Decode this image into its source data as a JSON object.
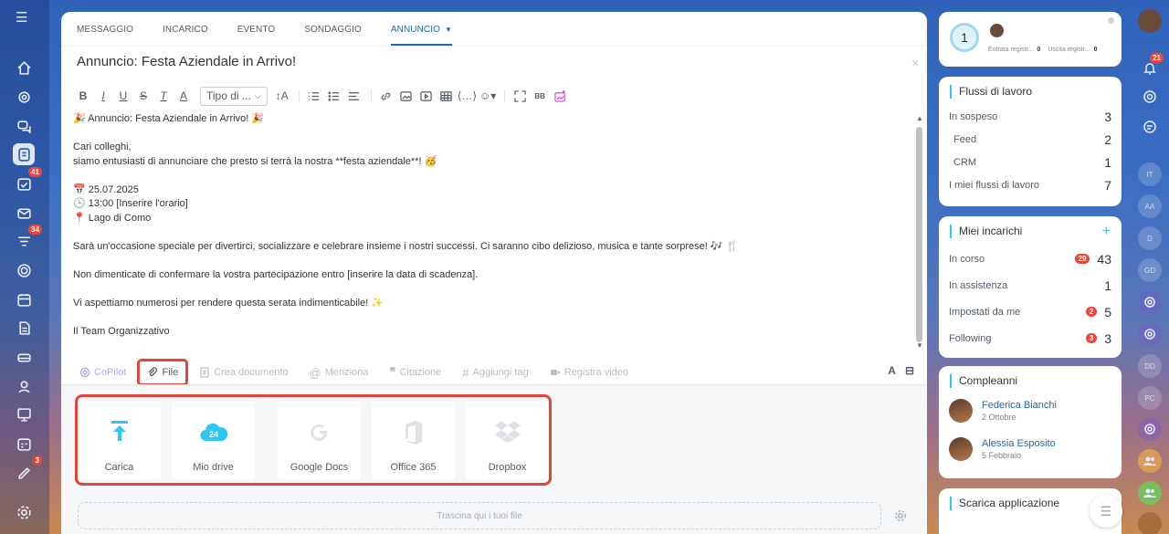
{
  "composer": {
    "tabs": [
      "MESSAGGIO",
      "INCARICO",
      "EVENTO",
      "SONDAGGIO",
      "ANNUNCIO"
    ],
    "active_tab": "ANNUNCIO",
    "title": "Annuncio: Festa Aziendale in Arrivo!",
    "toolbar": {
      "font_select": "Tipo di ...",
      "bbcode_label": "BB"
    },
    "editor_lines": [
      "🎉 Annuncio: Festa Aziendale in Arrivo! 🎉",
      "",
      "Cari colleghi,",
      "siamo entusiasti di annunciare che presto si terrà la nostra **festa aziendale**! 🥳",
      "",
      "📅 25.07.2025",
      "🕒 13:00 [Inserire l'orario]",
      "📍 Lago di Como",
      "",
      "Sarà un'occasione speciale per divertirci, socializzare e celebrare insieme i nostri successi. Ci saranno cibo delizioso, musica e tante sorprese! 🎶 🍴",
      "",
      "Non dimenticate di confermare la vostra partecipazione entro [inserire la data di scadenza].",
      "",
      "Vi aspettiamo numerosi per rendere questa serata indimenticabile! ✨",
      "",
      "Il Team Organizzativo"
    ],
    "bottom_actions": {
      "copilot": "CoPilot",
      "file": "File",
      "create_doc": "Crea documento",
      "mention": "Menziona",
      "quote": "Citazione",
      "tag": "Aggiungi tag",
      "video": "Registra video"
    },
    "upload_providers": [
      {
        "label": "Carica",
        "icon": "upload-icon"
      },
      {
        "label": "Mio drive",
        "icon": "cloud-drive-icon",
        "badge": "24"
      },
      {
        "label": "Google Docs",
        "icon": "google-icon"
      },
      {
        "label": "Office 365",
        "icon": "office-icon"
      },
      {
        "label": "Dropbox",
        "icon": "dropbox-icon"
      }
    ],
    "dropzone": "Trascina qui i tuoi file"
  },
  "right_panel": {
    "attendance": {
      "count": "1",
      "entry_label": "Entrata registr...",
      "entry_value": "0",
      "exit_label": "Uscita registr...",
      "exit_value": "0"
    },
    "workflows": {
      "title": "Flussi di lavoro",
      "rows": [
        {
          "label": "In sospeso",
          "value": "3"
        },
        {
          "label": "Feed",
          "value": "2"
        },
        {
          "label": "CRM",
          "value": "1"
        },
        {
          "label": "I miei flussi di lavoro",
          "value": "7"
        }
      ]
    },
    "tasks": {
      "title": "Miei incarichi",
      "plus": "+",
      "rows": [
        {
          "label": "In corso",
          "badge": "29",
          "value": "43"
        },
        {
          "label": "In assistenza",
          "badge": "",
          "value": "1"
        },
        {
          "label": "Impostati da me",
          "badge": "2",
          "value": "5"
        },
        {
          "label": "Following",
          "badge": "3",
          "value": "3"
        }
      ]
    },
    "birthdays": {
      "title": "Compleanni",
      "people": [
        {
          "name": "Federica Bianchi",
          "date": "2 Ottobre"
        },
        {
          "name": "Alessia Esposito",
          "date": "5 Febbraio"
        }
      ]
    },
    "apps": {
      "title": "Scarica applicazione"
    }
  },
  "left_sidebar": {
    "badges": {
      "tasks": "41",
      "feed": "34",
      "extra": "3"
    }
  },
  "right_sidebar": {
    "notifications": "21",
    "avatars": [
      "IT",
      "AA",
      "D",
      "GD",
      "DD",
      "PC"
    ]
  },
  "colors": {
    "accent": "#2066b0",
    "badge_red": "#f0453b",
    "highlight_box": "#e0463c",
    "card_line": "#2fc6f6"
  }
}
